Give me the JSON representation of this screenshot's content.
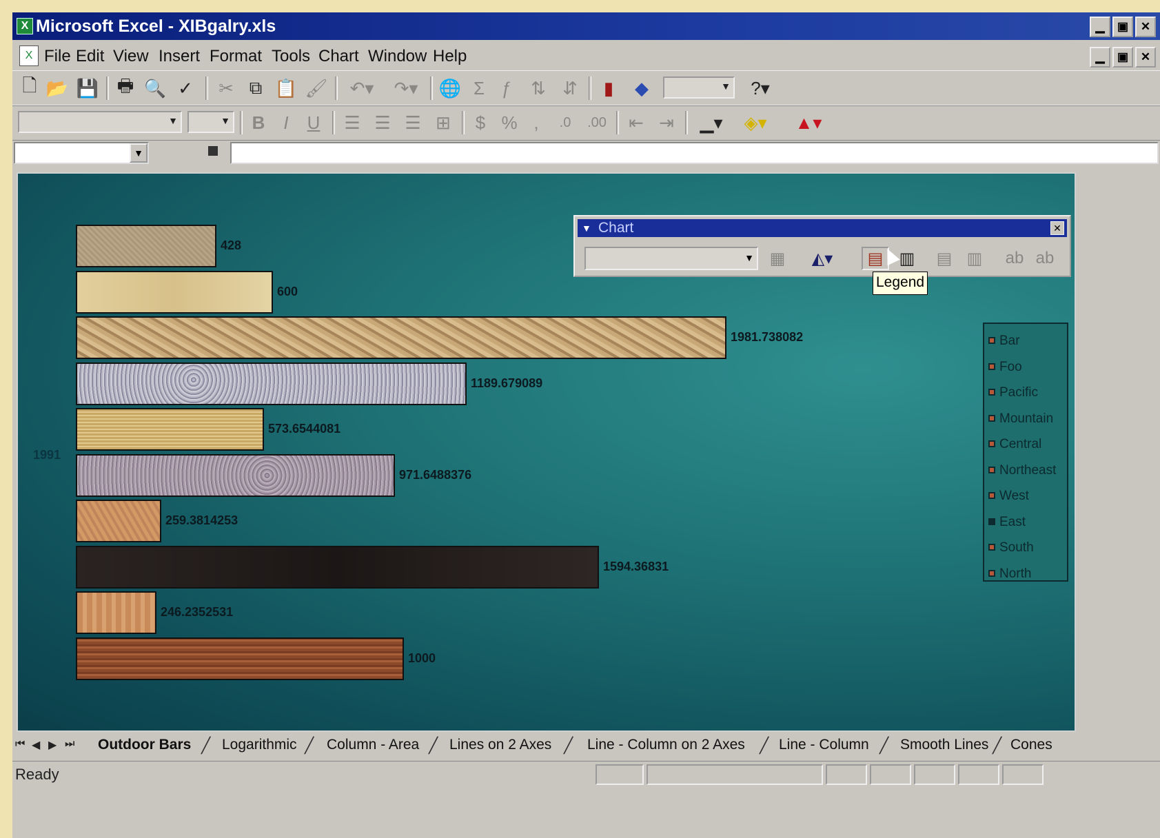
{
  "window": {
    "title": "Microsoft Excel - XIBgalry.xls",
    "controls": [
      "▁",
      "▣",
      "✕"
    ]
  },
  "menu": {
    "items": [
      "File",
      "Edit",
      "View",
      "Insert",
      "Format",
      "Tools",
      "Chart",
      "Window",
      "Help"
    ],
    "mdi_controls": [
      "▁",
      "▣",
      "✕"
    ]
  },
  "chart_toolbar": {
    "title": "Chart",
    "tooltip": "Legend"
  },
  "chart_data": {
    "type": "bar",
    "orientation": "horizontal",
    "category_label": "1991",
    "values": [
      428,
      600,
      1981.738082,
      1189.679089,
      573.6544081,
      971.6488376,
      259.3814253,
      1594.36831,
      246.2352531,
      1000
    ],
    "value_labels": [
      "428",
      "600",
      "1981.738082",
      "1189.679089",
      "573.6544081",
      "971.6488376",
      "259.3814253",
      "1594.36831",
      "246.2352531",
      "1000"
    ],
    "legend": [
      "Bar",
      "Foo",
      "Pacific",
      "Mountain",
      "Central",
      "Northeast",
      "West",
      "East",
      "South",
      "North"
    ],
    "legend_placement": "right"
  },
  "sheet_tabs": [
    "Outdoor Bars",
    "Logarithmic",
    "Column - Area",
    "Lines on 2 Axes",
    "Line - Column on 2 Axes",
    "Line - Column",
    "Smooth Lines",
    "Cones"
  ],
  "status": {
    "text": "Ready"
  },
  "icons": {
    "nav": [
      "⏮",
      "◀",
      "▶",
      "⏭"
    ]
  }
}
